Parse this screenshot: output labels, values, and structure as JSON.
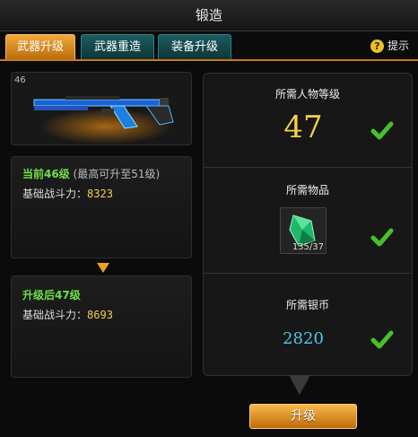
{
  "window": {
    "title": "锻造"
  },
  "tabs": [
    {
      "label": "武器升级",
      "active": true
    },
    {
      "label": "武器重造",
      "active": false
    },
    {
      "label": "装备升级",
      "active": false
    }
  ],
  "hint": {
    "label": "提示",
    "icon": "help-icon"
  },
  "weapon": {
    "level_badge": "46"
  },
  "current": {
    "level_text": "当前46级",
    "max_text": "(最高可升至51级)",
    "power_label": "基础战斗力：",
    "power_value": "8323"
  },
  "after": {
    "level_text": "升级后47级",
    "power_label": "基础战斗力：",
    "power_value": "8693"
  },
  "requirements": {
    "level": {
      "title": "所需人物等级",
      "value": "47"
    },
    "item": {
      "title": "所需物品",
      "count": "135/37"
    },
    "coins": {
      "title": "所需银币",
      "value": "2820"
    }
  },
  "upgrade_button": {
    "label": "升级"
  },
  "colors": {
    "accent_orange": "#f0a020",
    "tab_teal": "#1c5c60",
    "green_text": "#6fe04a",
    "gold_number": "#f3d04a",
    "coin_number": "#4fc6e8",
    "check_green": "#48c02a"
  }
}
